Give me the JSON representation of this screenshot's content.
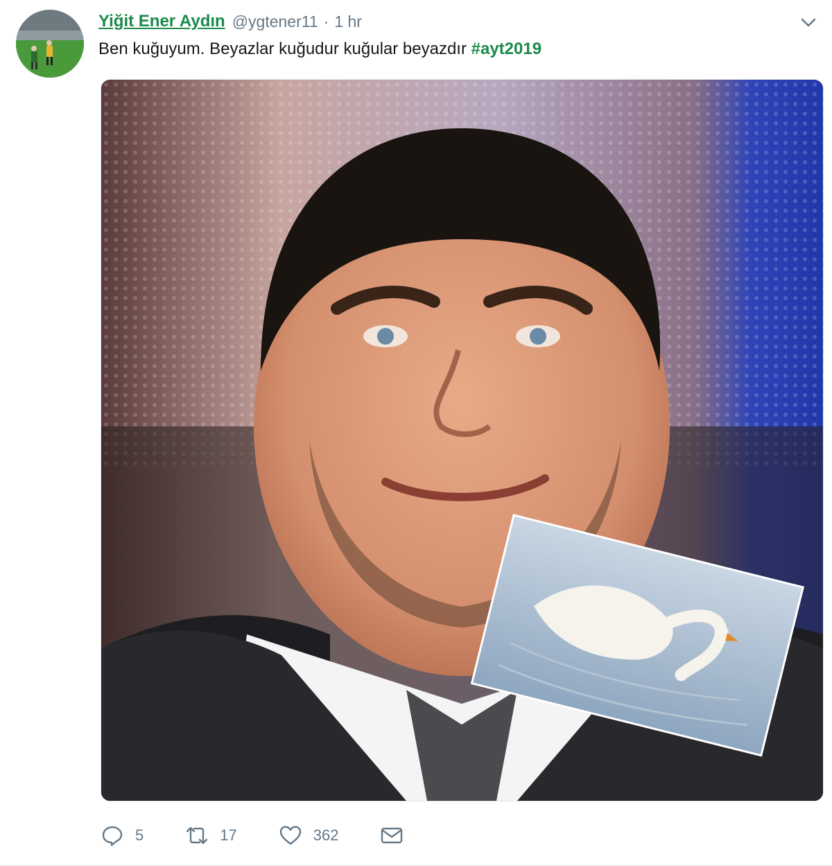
{
  "tweet": {
    "author_name": "Yiğit Ener Aydın",
    "author_handle": "@ygtener11",
    "separator": "·",
    "timestamp": "1 hr",
    "text": "Ben kuğuyum. Beyazlar kuğudur kuğular beyazdır ",
    "hashtag": "#ayt2019",
    "media": {
      "main_subject": "smiling man in dark suit and tie",
      "overlay_subject": "white swan on water"
    },
    "actions": {
      "reply_count": "5",
      "retweet_count": "17",
      "like_count": "362"
    }
  },
  "colors": {
    "accent": "#1a8a4a",
    "meta_text": "#657786",
    "text": "#14171a"
  },
  "icons": {
    "more": "chevron-down-icon",
    "reply": "reply-icon",
    "retweet": "retweet-icon",
    "like": "heart-icon",
    "dm": "envelope-icon"
  }
}
